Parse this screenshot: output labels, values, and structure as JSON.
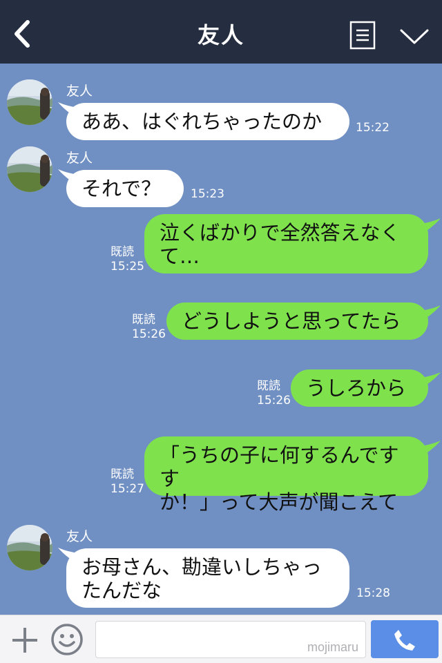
{
  "header": {
    "title": "友人",
    "back_icon": "chevron-left-icon",
    "menu_icon": "menu-icon",
    "dropdown_icon": "chevron-down-icon"
  },
  "messages": [
    {
      "side": "in",
      "sender": "友人",
      "text": "ああ、はぐれちゃったのか",
      "time": "15:22"
    },
    {
      "side": "in",
      "sender": "友人",
      "text": "それで？",
      "time": "15:23"
    },
    {
      "side": "out",
      "read": "既読",
      "text_lines": [
        "泣くばかりで全然答えなく",
        "て…"
      ],
      "time": "15:25"
    },
    {
      "side": "out",
      "read": "既読",
      "text": "どうしようと思ってたら",
      "time": "15:26"
    },
    {
      "side": "out",
      "read": "既読",
      "text": "うしろから",
      "time": "15:26"
    },
    {
      "side": "out",
      "read": "既読",
      "text_lines": [
        "「うちの子に何するんですす",
        "か！」って大声が聞こえて"
      ],
      "time": "15:27"
    },
    {
      "side": "in",
      "sender": "友人",
      "text_lines": [
        "お母さん、勘違いしちゃっ",
        "たんだな"
      ],
      "time": "15:28"
    }
  ],
  "footer": {
    "input_placeholder": "",
    "watermark": "mojimaru",
    "plus_icon": "plus-icon",
    "smile_icon": "smile-icon",
    "call_icon": "phone-icon"
  },
  "colors": {
    "header_bg": "#252d40",
    "chat_bg": "#7090c4",
    "incoming_bubble": "#ffffff",
    "outgoing_bubble": "#7fe24d",
    "send_button": "#5b8ee6"
  }
}
